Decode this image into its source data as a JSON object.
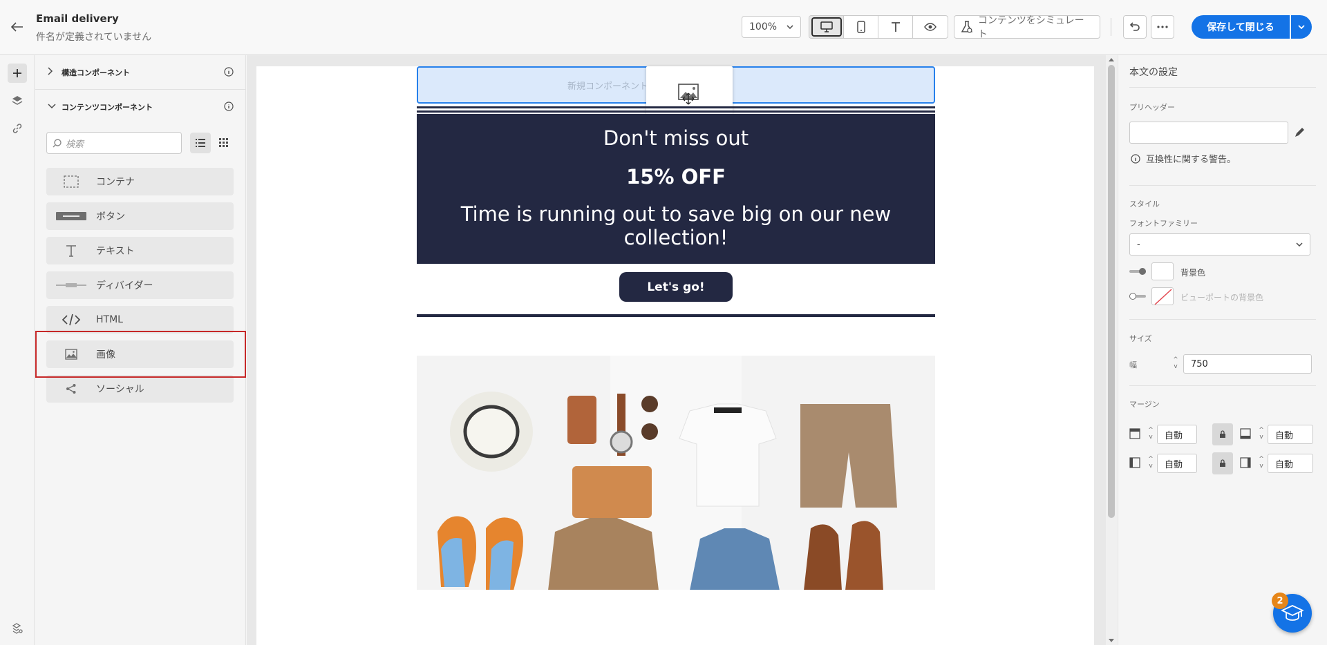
{
  "header": {
    "title": "Email delivery",
    "subtitle": "件名が定義されていません",
    "zoom": "100%",
    "simulate_label": "コンテンツをシミュレート",
    "save_label": "保存して閉じる"
  },
  "left_panel": {
    "structure_section": "構造コンポーネント",
    "content_section": "コンテンツコンポーネント",
    "search_placeholder": "検索",
    "components": [
      {
        "label": "コンテナ",
        "icon": "container-icon"
      },
      {
        "label": "ボタン",
        "icon": "button-icon"
      },
      {
        "label": "テキスト",
        "icon": "text-icon"
      },
      {
        "label": "ディバイダー",
        "icon": "divider-icon"
      },
      {
        "label": "HTML",
        "icon": "html-icon"
      },
      {
        "label": "画像",
        "icon": "image-icon"
      },
      {
        "label": "ソーシャル",
        "icon": "share-icon"
      }
    ]
  },
  "canvas": {
    "new_component_placeholder": "新規コンポーネント",
    "drag_label": "画像",
    "hero_line1": "Don't miss out",
    "hero_line2": "15% OFF",
    "hero_line3": "Time is running out to save big on our new collection!",
    "cta_label": "Let's go!"
  },
  "right_panel": {
    "title": "本文の設定",
    "preheader_label": "プリヘッダー",
    "preheader_value": "",
    "compat_warning": "互換性に関する警告。",
    "style_label": "スタイル",
    "font_family_label": "フォントファミリー",
    "font_family_value": "-",
    "bg_color_label": "背景色",
    "viewport_bg_label": "ビューポートの背景色",
    "size_label": "サイズ",
    "width_label": "幅",
    "width_value": "750",
    "margin_label": "マージン",
    "margin_top": "自動",
    "margin_bottom": "自動",
    "margin_left": "自動",
    "margin_right": "自動"
  },
  "help": {
    "badge_count": "2"
  },
  "colors": {
    "accent": "#1473e6",
    "hero_bg": "#232842",
    "highlight": "#c62828",
    "drop_zone": "#dbe9fb"
  }
}
